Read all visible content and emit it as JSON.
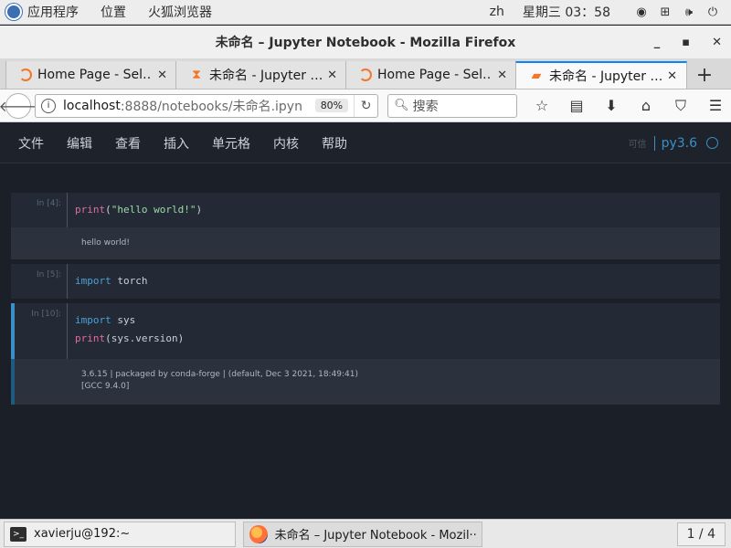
{
  "topbar": {
    "apps_label": "应用程序",
    "places_label": "位置",
    "firefox_label": "火狐浏览器",
    "lang": "zh",
    "clock": "星期三 03：58"
  },
  "window": {
    "title": "未命名 – Jupyter Notebook - Mozilla Firefox"
  },
  "tabs": [
    {
      "label": "Home Page - Sel…",
      "icon": "jupyter-icon"
    },
    {
      "label": "未命名 - Jupyter …",
      "icon": "hourglass-icon"
    },
    {
      "label": "Home Page - Sel…",
      "icon": "jupyter-icon"
    },
    {
      "label": "未命名 - Jupyter …",
      "icon": "notebook-icon"
    }
  ],
  "nav": {
    "url_host": "localhost",
    "url_path": ":8888/notebooks/未命名.ipyn",
    "zoom": "80%",
    "search_placeholder": "搜索"
  },
  "jupyter": {
    "menu": [
      "文件",
      "编辑",
      "查看",
      "插入",
      "单元格",
      "内核",
      "帮助"
    ],
    "trusted": "可信",
    "kernel": "py3.6"
  },
  "cells": [
    {
      "prompt": "In [4]:",
      "output": "hello world!"
    },
    {
      "prompt": "In [5]:"
    },
    {
      "prompt": "In [10]:",
      "output_lines": [
        "3.6.15 | packaged by conda-forge | (default, Dec  3 2021, 18:49:41)",
        "[GCC 9.4.0]"
      ]
    }
  ],
  "code": {
    "c1_fn": "print",
    "c1_str": "\"hello world!\"",
    "c2_kw": "import",
    "c2_mod": "torch",
    "c3_kw": "import",
    "c3_mod": "sys",
    "c3_fn": "print",
    "c3_arg": "sys.version"
  },
  "taskbar": {
    "terminal": "xavierju@192:~",
    "firefox": "未命名 – Jupyter Notebook - Mozil···",
    "pager": "1 / 4"
  }
}
